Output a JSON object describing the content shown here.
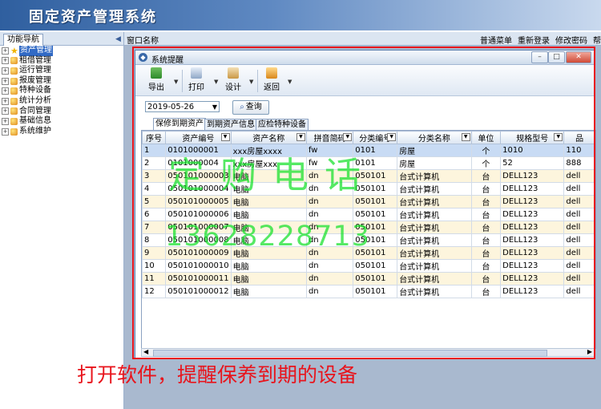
{
  "app": {
    "title": "固定资产管理系统"
  },
  "left": {
    "tab": "功能导航",
    "items": [
      {
        "label": "资产管理",
        "selected": true
      },
      {
        "label": "租借管理"
      },
      {
        "label": "运行管理"
      },
      {
        "label": "报废管理"
      },
      {
        "label": "特种设备"
      },
      {
        "label": "统计分析"
      },
      {
        "label": "合同管理"
      },
      {
        "label": "基础信息"
      },
      {
        "label": "系统维护"
      }
    ]
  },
  "topbar": {
    "window_name": "窗口名称",
    "links": [
      "普通菜单",
      "重新登录",
      "修改密码",
      "帮"
    ]
  },
  "window": {
    "title": "系统提醒",
    "toolbar": {
      "export": "导出",
      "print": "打印",
      "design": "设计",
      "back": "返回"
    },
    "date": "2019-05-26",
    "query": "查询",
    "tabs": [
      "保修到期资产",
      "到期资产信息",
      "应检特种设备"
    ],
    "columns": [
      "序号",
      "资产编号",
      "资产名称",
      "拼音简码",
      "分类编号",
      "分类名称",
      "单位",
      "规格型号",
      "品"
    ],
    "rows": [
      [
        "1",
        "0101000001",
        "xxx房屋xxxx",
        "fw",
        "0101",
        "房屋",
        "个",
        "1010",
        "110"
      ],
      [
        "2",
        "0101000004",
        "xxx房屋xxx",
        "fw",
        "0101",
        "房屋",
        "个",
        "52",
        "888"
      ],
      [
        "3",
        "050101000003",
        "电脑",
        "dn",
        "050101",
        "台式计算机",
        "台",
        "DELL123",
        "dell"
      ],
      [
        "4",
        "050101000004",
        "电脑",
        "dn",
        "050101",
        "台式计算机",
        "台",
        "DELL123",
        "dell"
      ],
      [
        "5",
        "050101000005",
        "电脑",
        "dn",
        "050101",
        "台式计算机",
        "台",
        "DELL123",
        "dell"
      ],
      [
        "6",
        "050101000006",
        "电脑",
        "dn",
        "050101",
        "台式计算机",
        "台",
        "DELL123",
        "dell"
      ],
      [
        "7",
        "050101000007",
        "电脑",
        "dn",
        "050101",
        "台式计算机",
        "台",
        "DELL123",
        "dell"
      ],
      [
        "8",
        "050101000008",
        "电脑",
        "dn",
        "050101",
        "台式计算机",
        "台",
        "DELL123",
        "dell"
      ],
      [
        "9",
        "050101000009",
        "电脑",
        "dn",
        "050101",
        "台式计算机",
        "台",
        "DELL123",
        "dell"
      ],
      [
        "10",
        "050101000010",
        "电脑",
        "dn",
        "050101",
        "台式计算机",
        "台",
        "DELL123",
        "dell"
      ],
      [
        "11",
        "050101000011",
        "电脑",
        "dn",
        "050101",
        "台式计算机",
        "台",
        "DELL123",
        "dell"
      ],
      [
        "12",
        "050101000012",
        "电脑",
        "dn",
        "050101",
        "台式计算机",
        "台",
        "DELL123",
        "dell"
      ]
    ]
  },
  "watermark": {
    "line1": "定购电话",
    "line2": "13628228713"
  },
  "caption": "打开软件，提醒保养到期的设备"
}
